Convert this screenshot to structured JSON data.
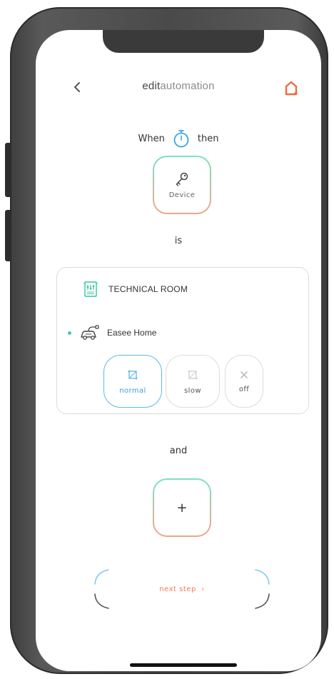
{
  "header": {
    "title_bold": "edit",
    "title_light": "automation",
    "back_icon": "chevron-left-icon",
    "home_icon": "home-icon"
  },
  "trigger": {
    "when_label": "When",
    "then_label": "then",
    "timer_icon": "stopwatch-icon",
    "device_label": "Device",
    "device_icon": "key-icon"
  },
  "condition": {
    "is_label": "is",
    "room_label": "TECHNICAL ROOM",
    "room_icon": "switchboard-icon",
    "charger_label": "Easee Home",
    "charger_icon": "ev-charger-icon",
    "modes": [
      {
        "label": "normal",
        "selected": true
      },
      {
        "label": "slow",
        "selected": false
      },
      {
        "label": "off",
        "selected": false
      }
    ]
  },
  "and_section": {
    "and_label": "and",
    "add_label": "+"
  },
  "footer": {
    "next_label": "next step",
    "next_arrow": "›"
  },
  "colors": {
    "accent_orange": "#f07a5a",
    "accent_teal": "#35d0b4",
    "accent_blue": "#5bb8ea"
  }
}
